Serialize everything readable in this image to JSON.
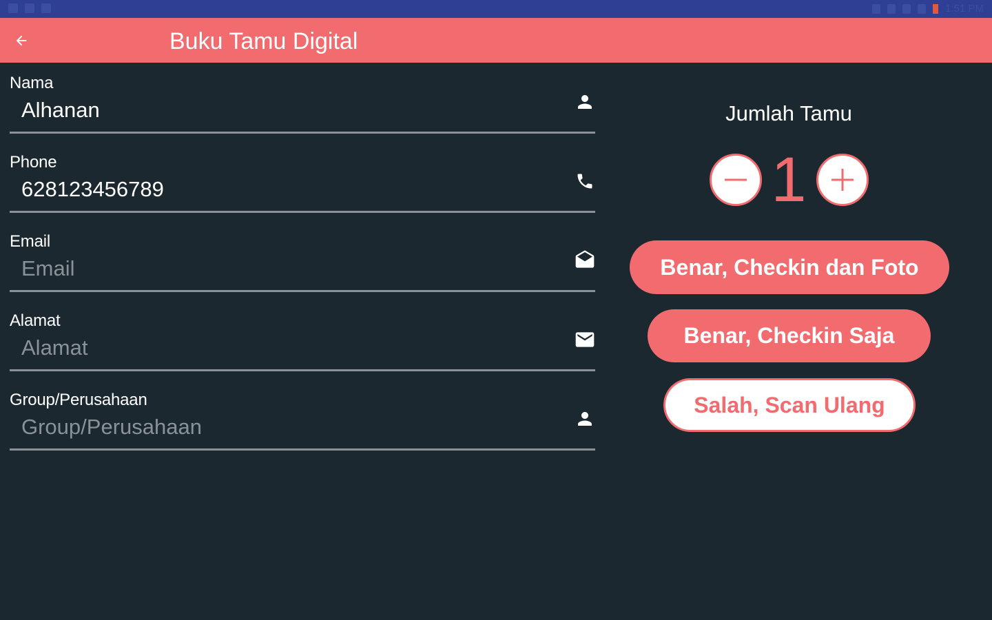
{
  "statusbar": {
    "time": "1:51 PM"
  },
  "appbar": {
    "title": "Buku Tamu Digital",
    "back_icon": "arrow-left-icon"
  },
  "form": {
    "fields": [
      {
        "label": "Nama",
        "value": "Alhanan",
        "placeholder": "Nama",
        "icon": "person-icon"
      },
      {
        "label": "Phone",
        "value": "628123456789",
        "placeholder": "Phone",
        "icon": "phone-icon"
      },
      {
        "label": "Email",
        "value": "",
        "placeholder": "Email",
        "icon": "open-envelope-icon"
      },
      {
        "label": "Alamat",
        "value": "",
        "placeholder": "Alamat",
        "icon": "envelope-icon"
      },
      {
        "label": "Group/Perusahaan",
        "value": "",
        "placeholder": "Group/Perusahaan",
        "icon": "person-icon"
      }
    ]
  },
  "guests": {
    "label": "Jumlah Tamu",
    "count": "1",
    "decrement_icon": "minus-icon",
    "increment_icon": "plus-icon"
  },
  "actions": {
    "checkin_photo": "Benar, Checkin dan Foto",
    "checkin_only": "Benar, Checkin Saja",
    "rescan": "Salah, Scan Ulang"
  },
  "colors": {
    "accent": "#f16b6f",
    "background": "#1c2830",
    "statusbar": "#2e3f94",
    "underline": "#8a9297"
  }
}
